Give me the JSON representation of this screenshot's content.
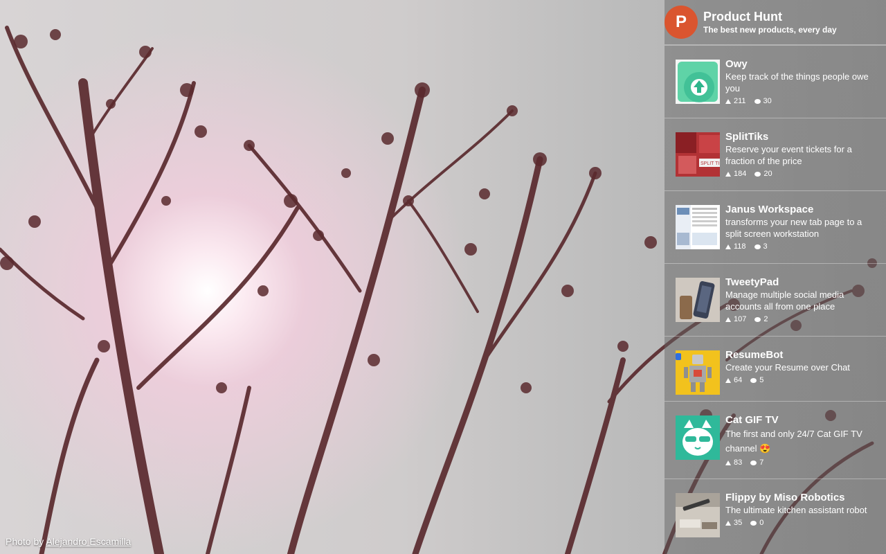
{
  "background": {
    "credit_prefix": "Photo by",
    "credit_author": "Alejandro Escamilla"
  },
  "product_hunt": {
    "logo_letter": "P",
    "title": "Product Hunt",
    "tagline": "The best new products, every day",
    "items": [
      {
        "name": "Owy",
        "desc": "Keep track of the things people owe you",
        "votes": "211",
        "comments": "30",
        "thumb": "owy-logo"
      },
      {
        "name": "SplitTiks",
        "desc": "Reserve your event tickets for a fraction of the price",
        "votes": "184",
        "comments": "20",
        "thumb": "splittiks-image"
      },
      {
        "name": "Janus Workspace",
        "desc": "transforms your new tab page to a split screen workstation",
        "votes": "118",
        "comments": "3",
        "thumb": "janus-screenshot"
      },
      {
        "name": "TweetyPad",
        "desc": "Manage multiple social media accounts all from one place",
        "votes": "107",
        "comments": "2",
        "thumb": "tweetypad-photo"
      },
      {
        "name": "ResumeBot",
        "desc": "Create your Resume over Chat",
        "votes": "64",
        "comments": "5",
        "thumb": "resumebot-robot"
      },
      {
        "name": "Cat GIF TV",
        "desc": "The first and only 24/7 Cat GIF TV channel 😍",
        "votes": "83",
        "comments": "7",
        "thumb": "cat-gif-tv-logo"
      },
      {
        "name": "Flippy by Miso Robotics",
        "desc": "The ultimate kitchen assistant robot",
        "votes": "35",
        "comments": "0",
        "thumb": "flippy-photo"
      }
    ]
  },
  "colors": {
    "ph_orange": "#da552f",
    "branch": "#5a2a2e"
  }
}
